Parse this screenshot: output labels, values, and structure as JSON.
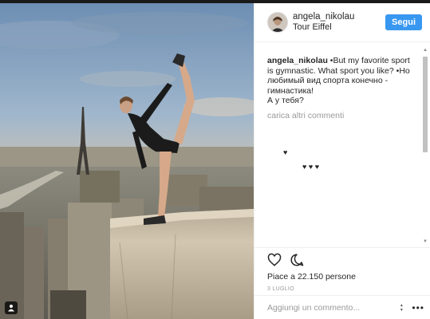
{
  "post": {
    "username": "angela_nikolau",
    "location": "Tour Eiffel",
    "follow_label": "Segui",
    "caption_user": "angela_nikolau",
    "caption_text": " •But my favorite sport is gymnastic. What sport you like? •Но любимый вид спорта конечно - гимнастика!",
    "caption_line2": "А у тебя?",
    "load_more": "carica altri commenti",
    "emoji_1": "♥",
    "emoji_2": "♥ ♥ ♥",
    "likes": "Piace a 22.150 persone",
    "date": "3 LUGLIO",
    "comment_placeholder": "Aggiungi un commento...",
    "more_label": "•••"
  },
  "icons": {
    "like": "heart-outline-icon",
    "comment": "comment-bubble-icon",
    "tag": "person-tag-icon",
    "more": "more-dots-icon"
  },
  "colors": {
    "accent": "#3897f0",
    "text": "#262626",
    "muted": "#999999",
    "border": "#efefef"
  }
}
